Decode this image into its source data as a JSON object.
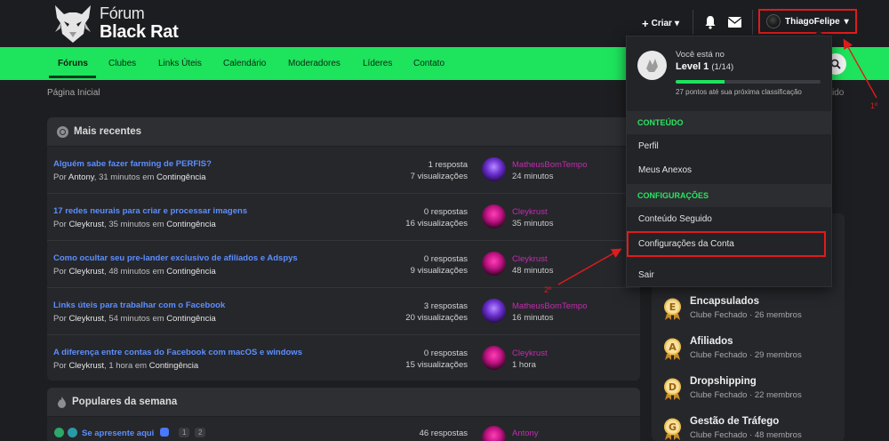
{
  "header": {
    "logo_line1": "Fórum",
    "logo_line2": "Black Rat",
    "create_label": "Criar",
    "username": "ThiagoFelipe"
  },
  "nav": {
    "items": [
      "Fóruns",
      "Clubes",
      "Links Úteis",
      "Calendário",
      "Moderadores",
      "Líderes",
      "Contato"
    ],
    "active": "Fóruns"
  },
  "breadcrumb": {
    "home": "Página Inicial",
    "right_fragment": "ido"
  },
  "recent": {
    "title": "Mais recentes",
    "rows": [
      {
        "title": "Alguém sabe fazer farming de PERFIS?",
        "author": "Antony",
        "when": "31 minutos",
        "forum": "Contingência",
        "replies": "1 resposta",
        "views": "7 visualizações",
        "last_user": "MatheusBomTempo",
        "last_time": "24 minutos"
      },
      {
        "title": "17 redes neurais para criar e processar imagens",
        "author": "Cleykrust",
        "when": "35 minutos",
        "forum": "Contingência",
        "replies": "0 respostas",
        "views": "16 visualizações",
        "last_user": "Cleykrust",
        "last_time": "35 minutos"
      },
      {
        "title": "Como ocultar seu pre-lander exclusivo de afiliados e Adspys",
        "author": "Cleykrust",
        "when": "48 minutos",
        "forum": "Contingência",
        "replies": "0 respostas",
        "views": "9 visualizações",
        "last_user": "Cleykrust",
        "last_time": "48 minutos"
      },
      {
        "title": "Links úteis para trabalhar com o Facebook",
        "author": "Cleykrust",
        "when": "54 minutos",
        "forum": "Contingência",
        "replies": "3 respostas",
        "views": "20 visualizações",
        "last_user": "MatheusBomTempo",
        "last_time": "16 minutos"
      },
      {
        "title": "A diferença entre contas do Facebook com macOS e windows",
        "author": "Cleykrust",
        "when": "1 hora",
        "forum": "Contingência",
        "replies": "0 respostas",
        "views": "15 visualizações",
        "last_user": "Cleykrust",
        "last_time": "1 hora"
      }
    ],
    "by_label": "Por",
    "in_label": "em"
  },
  "popular": {
    "title": "Populares da semana",
    "row_title": "Se apresente aqui",
    "pages": [
      "1",
      "2"
    ],
    "replies": "46 respostas",
    "last_user": "Antony"
  },
  "clubs": [
    {
      "letter": "E",
      "name": "Encapsulados",
      "type": "Clube Fechado",
      "members": "26 membros"
    },
    {
      "letter": "A",
      "name": "Afiliados",
      "type": "Clube Fechado",
      "members": "29 membros"
    },
    {
      "letter": "D",
      "name": "Dropshipping",
      "type": "Clube Fechado",
      "members": "22 membros"
    },
    {
      "letter": "G",
      "name": "Gestão de Tráfego",
      "type": "Clube Fechado",
      "members": "48 membros"
    }
  ],
  "dropdown": {
    "level_top": "Você está no",
    "level_name": "Level 1",
    "level_fraction": "(1/14)",
    "progress_fraction": 0.34,
    "level_note": "27 pontos até sua próxima classificação",
    "section_content": "CONTEÚDO",
    "profile": "Perfil",
    "attachments": "Meus Anexos",
    "section_settings": "CONFIGURAÇÕES",
    "followed": "Conteúdo Seguido",
    "account_settings": "Configurações da Conta",
    "logout": "Sair"
  },
  "annotations": {
    "step1": "1º",
    "step2": "2º"
  },
  "colors": {
    "accent_green": "#1ee35c",
    "link_blue": "#5b8fff",
    "annotation_red": "#e01b1b",
    "username_pink": "#c42bb0"
  }
}
